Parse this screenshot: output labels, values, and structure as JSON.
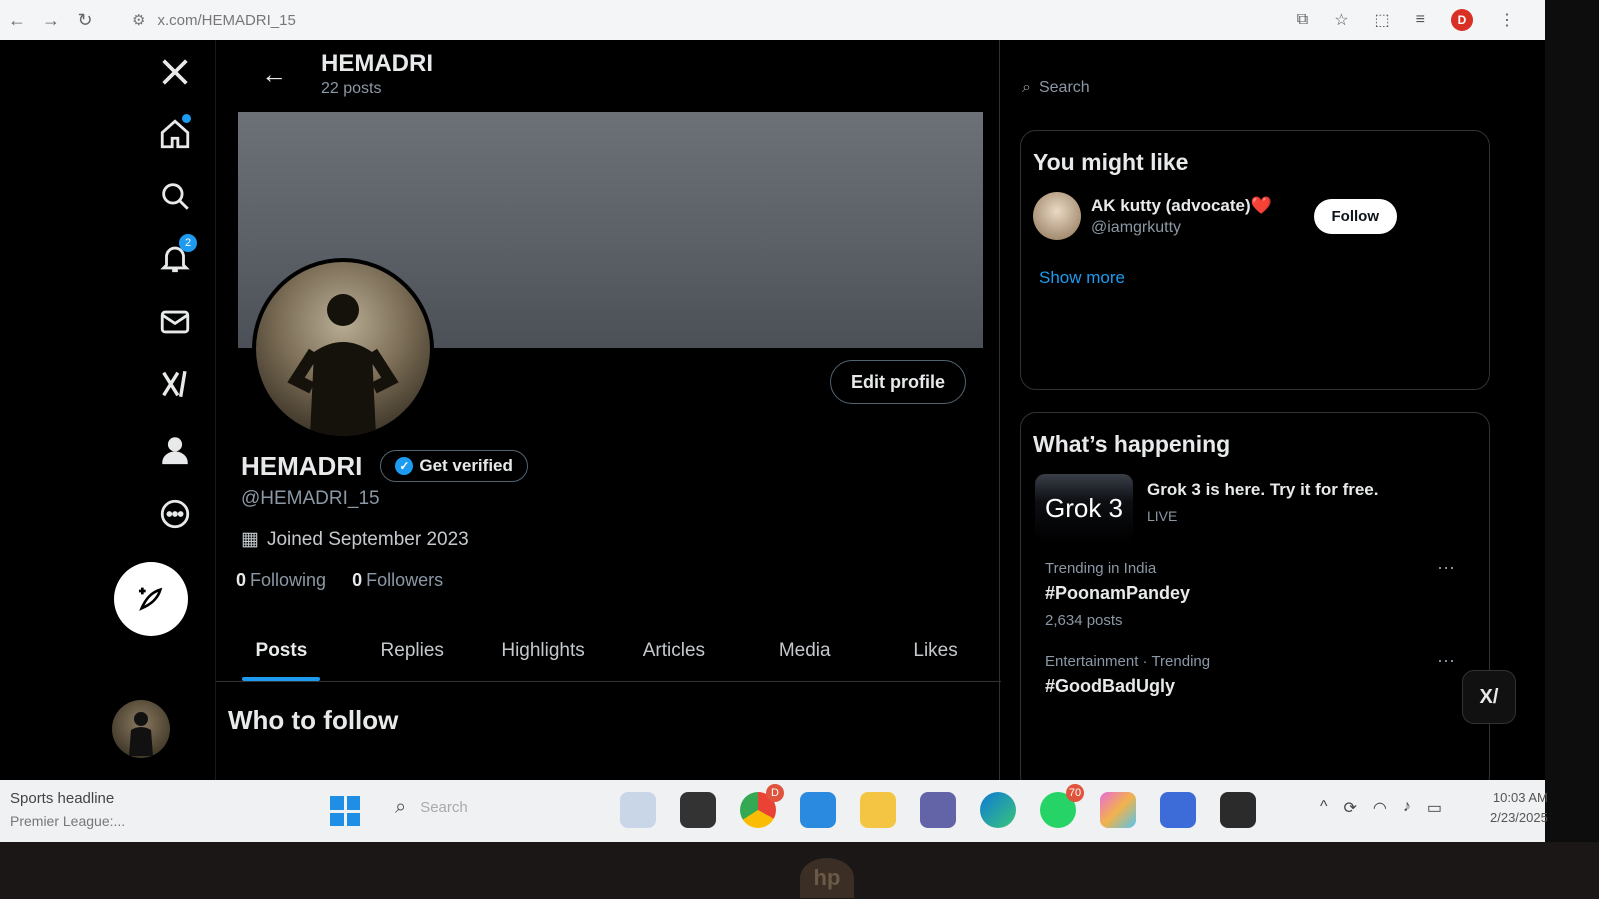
{
  "browser": {
    "url": "x.com/HEMADRI_15",
    "profile_initial": "D"
  },
  "header": {
    "title": "HEMADRI",
    "post_count": "22 posts"
  },
  "nav": {
    "notifications_badge": "2"
  },
  "profile": {
    "display_name": "HEMADRI",
    "get_verified_label": "Get verified",
    "handle": "@HEMADRI_15",
    "joined": "Joined September 2023",
    "following_count": "0",
    "following_label": "Following",
    "followers_count": "0",
    "followers_label": "Followers",
    "edit_profile_label": "Edit profile"
  },
  "tabs": [
    {
      "label": "Posts"
    },
    {
      "label": "Replies"
    },
    {
      "label": "Highlights"
    },
    {
      "label": "Articles"
    },
    {
      "label": "Media"
    },
    {
      "label": "Likes"
    }
  ],
  "who_to_follow": {
    "title": "Who to follow"
  },
  "sidebar": {
    "search_placeholder": "Search",
    "you_might_like": {
      "title": "You might like",
      "name": "AK kutty (advocate)❤️",
      "handle": "@iamgrkutty",
      "follow_label": "Follow",
      "show_more": "Show more"
    },
    "whats_happening": {
      "title": "What’s happening",
      "grok_thumb": "Grok 3",
      "grok_title": "Grok 3 is here. Try it for free.",
      "grok_live": "LIVE",
      "trends": [
        {
          "meta": "Trending in India",
          "tag": "#PoonamPandey",
          "count": "2,634 posts"
        },
        {
          "meta": "Entertainment · Trending",
          "tag": "#GoodBadUgly",
          "count": ""
        }
      ]
    },
    "grok_button": "X/"
  },
  "taskbar": {
    "news_title": "Sports headline",
    "news_sub": "Premier League:...",
    "search_placeholder": "Search",
    "chrome_badge": "D",
    "whatsapp_badge": "70",
    "time": "10:03 AM",
    "date": "2/23/2025"
  },
  "colors": {
    "accent": "#1d9bf0",
    "background": "#000000",
    "text": "#e7e9ea",
    "muted": "#8b98a5"
  },
  "icons": [
    "x-logo-icon",
    "home-icon",
    "search-icon",
    "bell-icon",
    "mail-icon",
    "grok-icon",
    "person-icon",
    "more-icon",
    "compose-icon",
    "back-arrow-icon",
    "calendar-icon",
    "verified-check-icon"
  ]
}
